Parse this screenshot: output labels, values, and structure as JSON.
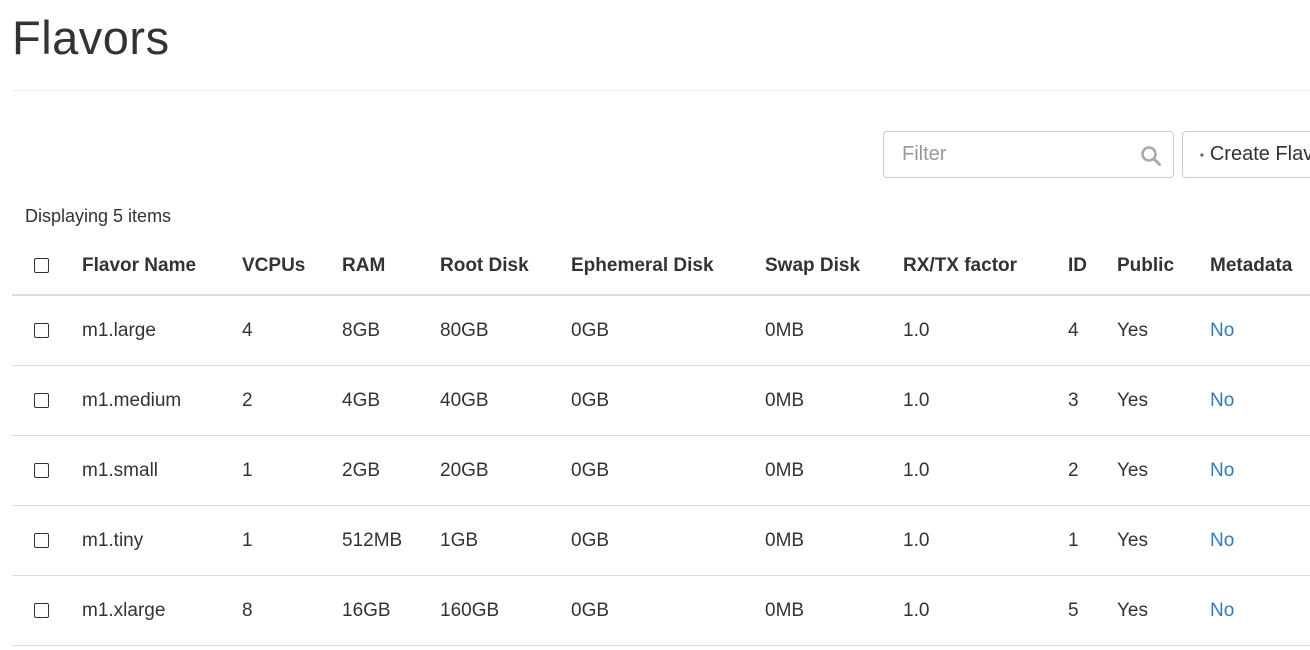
{
  "page": {
    "title": "Flavors"
  },
  "toolbar": {
    "filter_placeholder": "Filter",
    "filter_value": "",
    "create_label": "Create Flavor",
    "search_icon": "search-icon",
    "plus_icon": "plus-icon"
  },
  "table": {
    "count_text": "Displaying 5 items",
    "columns": [
      "Flavor Name",
      "VCPUs",
      "RAM",
      "Root Disk",
      "Ephemeral Disk",
      "Swap Disk",
      "RX/TX factor",
      "ID",
      "Public",
      "Metadata"
    ],
    "rows": [
      {
        "name": "m1.large",
        "vcpus": "4",
        "ram": "8GB",
        "root_disk": "80GB",
        "ephemeral_disk": "0GB",
        "swap_disk": "0MB",
        "rxtx": "1.0",
        "id": "4",
        "public": "Yes",
        "metadata": "No"
      },
      {
        "name": "m1.medium",
        "vcpus": "2",
        "ram": "4GB",
        "root_disk": "40GB",
        "ephemeral_disk": "0GB",
        "swap_disk": "0MB",
        "rxtx": "1.0",
        "id": "3",
        "public": "Yes",
        "metadata": "No"
      },
      {
        "name": "m1.small",
        "vcpus": "1",
        "ram": "2GB",
        "root_disk": "20GB",
        "ephemeral_disk": "0GB",
        "swap_disk": "0MB",
        "rxtx": "1.0",
        "id": "2",
        "public": "Yes",
        "metadata": "No"
      },
      {
        "name": "m1.tiny",
        "vcpus": "1",
        "ram": "512MB",
        "root_disk": "1GB",
        "ephemeral_disk": "0GB",
        "swap_disk": "0MB",
        "rxtx": "1.0",
        "id": "1",
        "public": "Yes",
        "metadata": "No"
      },
      {
        "name": "m1.xlarge",
        "vcpus": "8",
        "ram": "16GB",
        "root_disk": "160GB",
        "ephemeral_disk": "0GB",
        "swap_disk": "0MB",
        "rxtx": "1.0",
        "id": "5",
        "public": "Yes",
        "metadata": "No"
      }
    ]
  },
  "colors": {
    "link": "#337ab7",
    "text": "#333333",
    "border": "#dddddd"
  }
}
